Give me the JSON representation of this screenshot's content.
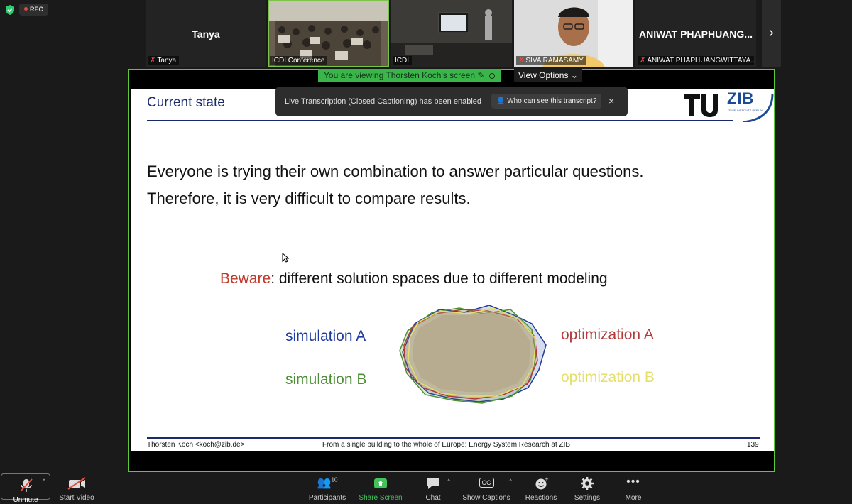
{
  "status": {
    "rec_label": "REC"
  },
  "participants": [
    {
      "name": "Tanya",
      "label": "Tanya",
      "muted": true
    },
    {
      "label": "ICDI Conference",
      "muted": false,
      "active": true
    },
    {
      "label": "ICDI",
      "muted": false
    },
    {
      "label": "SIVA RAMASAMY",
      "muted": true
    },
    {
      "name": "ANIWAT PHAPHUANG...",
      "label": "ANIWAT PHAPHUANGWITTAYA...",
      "muted": true
    }
  ],
  "share": {
    "viewing_text": "You are viewing Thorsten Koch's screen",
    "view_options": "View Options"
  },
  "toast": {
    "message": "Live Transcription (Closed Captioning) has been enabled",
    "who_label": "Who can see this transcript?",
    "close": "×"
  },
  "slide": {
    "title": "Current state",
    "logo": {
      "brand": "ZIB",
      "tu_sub": "berlin",
      "zib_sub": "ZUSE INSTITUTE BERLIN"
    },
    "line1": "Everyone is trying their own combination to answer particular questions.",
    "line2": "Therefore, it is very difficult to compare results.",
    "beware_word": "Beware",
    "beware_rest": ": different solution spaces due to different modeling",
    "labels": {
      "sim_a": "simulation A",
      "sim_b": "simulation B",
      "opt_a": "optimization A",
      "opt_b": "optimization B"
    },
    "colors": {
      "sim_a": "#1f3a9e",
      "sim_b": "#4e8f37",
      "opt_a": "#b23a3a",
      "opt_b": "#e6df6a"
    },
    "footer_left": "Thorsten Koch <koch@zib.de>",
    "footer_center": "From a single building to the whole of Europe: Energy System Research at ZIB",
    "footer_page": "139"
  },
  "toolbar": {
    "unmute": "Unmute",
    "start_video": "Start Video",
    "participants": "Participants",
    "participants_count": "10",
    "share_screen": "Share Screen",
    "chat": "Chat",
    "show_captions": "Show Captions",
    "captions_icon": "CC",
    "reactions": "Reactions",
    "settings": "Settings",
    "more": "More"
  }
}
